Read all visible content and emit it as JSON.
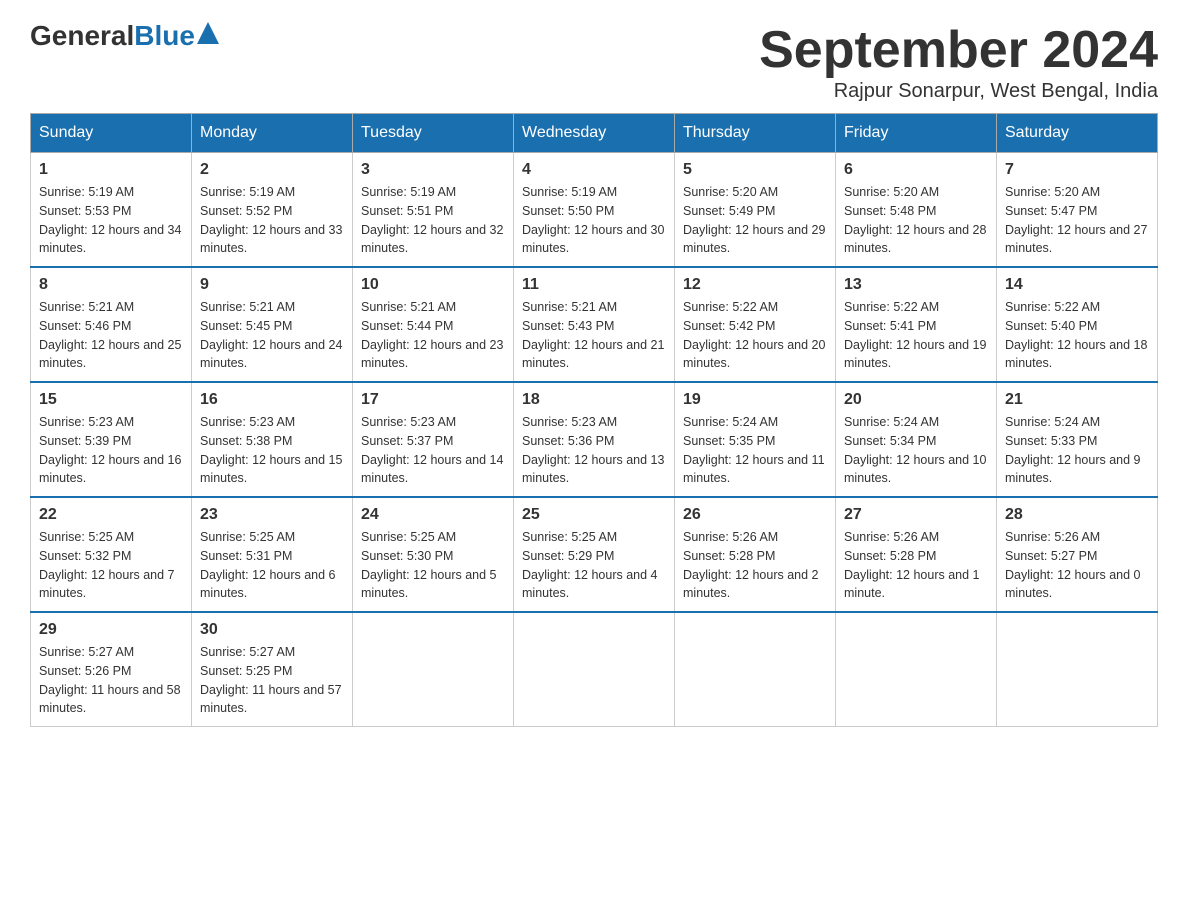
{
  "header": {
    "logo_general": "General",
    "logo_blue": "Blue",
    "month_title": "September 2024",
    "location": "Rajpur Sonarpur, West Bengal, India"
  },
  "days_of_week": [
    "Sunday",
    "Monday",
    "Tuesday",
    "Wednesday",
    "Thursday",
    "Friday",
    "Saturday"
  ],
  "weeks": [
    [
      {
        "day": "1",
        "sunrise": "5:19 AM",
        "sunset": "5:53 PM",
        "daylight": "12 hours and 34 minutes."
      },
      {
        "day": "2",
        "sunrise": "5:19 AM",
        "sunset": "5:52 PM",
        "daylight": "12 hours and 33 minutes."
      },
      {
        "day": "3",
        "sunrise": "5:19 AM",
        "sunset": "5:51 PM",
        "daylight": "12 hours and 32 minutes."
      },
      {
        "day": "4",
        "sunrise": "5:19 AM",
        "sunset": "5:50 PM",
        "daylight": "12 hours and 30 minutes."
      },
      {
        "day": "5",
        "sunrise": "5:20 AM",
        "sunset": "5:49 PM",
        "daylight": "12 hours and 29 minutes."
      },
      {
        "day": "6",
        "sunrise": "5:20 AM",
        "sunset": "5:48 PM",
        "daylight": "12 hours and 28 minutes."
      },
      {
        "day": "7",
        "sunrise": "5:20 AM",
        "sunset": "5:47 PM",
        "daylight": "12 hours and 27 minutes."
      }
    ],
    [
      {
        "day": "8",
        "sunrise": "5:21 AM",
        "sunset": "5:46 PM",
        "daylight": "12 hours and 25 minutes."
      },
      {
        "day": "9",
        "sunrise": "5:21 AM",
        "sunset": "5:45 PM",
        "daylight": "12 hours and 24 minutes."
      },
      {
        "day": "10",
        "sunrise": "5:21 AM",
        "sunset": "5:44 PM",
        "daylight": "12 hours and 23 minutes."
      },
      {
        "day": "11",
        "sunrise": "5:21 AM",
        "sunset": "5:43 PM",
        "daylight": "12 hours and 21 minutes."
      },
      {
        "day": "12",
        "sunrise": "5:22 AM",
        "sunset": "5:42 PM",
        "daylight": "12 hours and 20 minutes."
      },
      {
        "day": "13",
        "sunrise": "5:22 AM",
        "sunset": "5:41 PM",
        "daylight": "12 hours and 19 minutes."
      },
      {
        "day": "14",
        "sunrise": "5:22 AM",
        "sunset": "5:40 PM",
        "daylight": "12 hours and 18 minutes."
      }
    ],
    [
      {
        "day": "15",
        "sunrise": "5:23 AM",
        "sunset": "5:39 PM",
        "daylight": "12 hours and 16 minutes."
      },
      {
        "day": "16",
        "sunrise": "5:23 AM",
        "sunset": "5:38 PM",
        "daylight": "12 hours and 15 minutes."
      },
      {
        "day": "17",
        "sunrise": "5:23 AM",
        "sunset": "5:37 PM",
        "daylight": "12 hours and 14 minutes."
      },
      {
        "day": "18",
        "sunrise": "5:23 AM",
        "sunset": "5:36 PM",
        "daylight": "12 hours and 13 minutes."
      },
      {
        "day": "19",
        "sunrise": "5:24 AM",
        "sunset": "5:35 PM",
        "daylight": "12 hours and 11 minutes."
      },
      {
        "day": "20",
        "sunrise": "5:24 AM",
        "sunset": "5:34 PM",
        "daylight": "12 hours and 10 minutes."
      },
      {
        "day": "21",
        "sunrise": "5:24 AM",
        "sunset": "5:33 PM",
        "daylight": "12 hours and 9 minutes."
      }
    ],
    [
      {
        "day": "22",
        "sunrise": "5:25 AM",
        "sunset": "5:32 PM",
        "daylight": "12 hours and 7 minutes."
      },
      {
        "day": "23",
        "sunrise": "5:25 AM",
        "sunset": "5:31 PM",
        "daylight": "12 hours and 6 minutes."
      },
      {
        "day": "24",
        "sunrise": "5:25 AM",
        "sunset": "5:30 PM",
        "daylight": "12 hours and 5 minutes."
      },
      {
        "day": "25",
        "sunrise": "5:25 AM",
        "sunset": "5:29 PM",
        "daylight": "12 hours and 4 minutes."
      },
      {
        "day": "26",
        "sunrise": "5:26 AM",
        "sunset": "5:28 PM",
        "daylight": "12 hours and 2 minutes."
      },
      {
        "day": "27",
        "sunrise": "5:26 AM",
        "sunset": "5:28 PM",
        "daylight": "12 hours and 1 minute."
      },
      {
        "day": "28",
        "sunrise": "5:26 AM",
        "sunset": "5:27 PM",
        "daylight": "12 hours and 0 minutes."
      }
    ],
    [
      {
        "day": "29",
        "sunrise": "5:27 AM",
        "sunset": "5:26 PM",
        "daylight": "11 hours and 58 minutes."
      },
      {
        "day": "30",
        "sunrise": "5:27 AM",
        "sunset": "5:25 PM",
        "daylight": "11 hours and 57 minutes."
      },
      null,
      null,
      null,
      null,
      null
    ]
  ],
  "labels": {
    "sunrise_prefix": "Sunrise: ",
    "sunset_prefix": "Sunset: ",
    "daylight_prefix": "Daylight: "
  }
}
